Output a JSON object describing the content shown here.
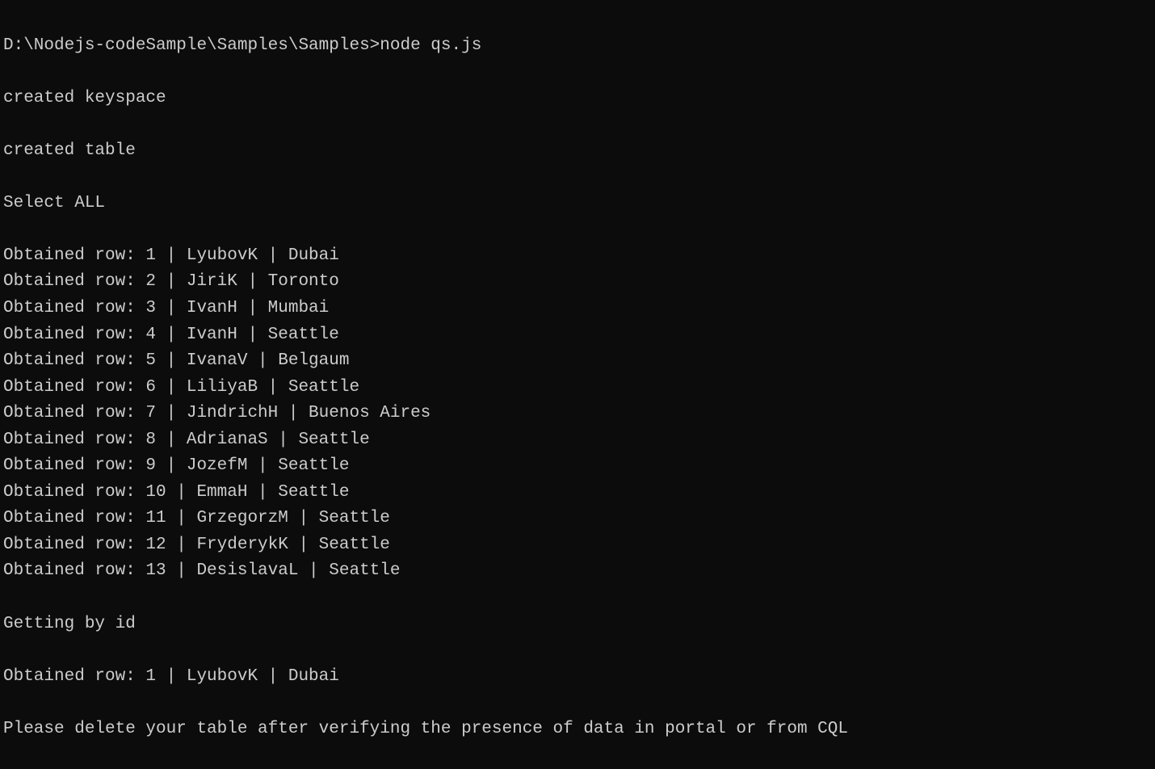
{
  "prompt": {
    "path": "D:\\Nodejs-codeSample\\Samples\\Samples>",
    "command": "node qs.js"
  },
  "output": {
    "created_keyspace": "created keyspace",
    "created_table": "created table",
    "select_all": "Select ALL",
    "rows": [
      {
        "prefix": "Obtained row: ",
        "id": "1",
        "name": "LyubovK",
        "city": "Dubai"
      },
      {
        "prefix": "Obtained row: ",
        "id": "2",
        "name": "JiriK",
        "city": "Toronto"
      },
      {
        "prefix": "Obtained row: ",
        "id": "3",
        "name": "IvanH",
        "city": "Mumbai"
      },
      {
        "prefix": "Obtained row: ",
        "id": "4",
        "name": "IvanH",
        "city": "Seattle"
      },
      {
        "prefix": "Obtained row: ",
        "id": "5",
        "name": "IvanaV",
        "city": "Belgaum"
      },
      {
        "prefix": "Obtained row: ",
        "id": "6",
        "name": "LiliyaB",
        "city": "Seattle"
      },
      {
        "prefix": "Obtained row: ",
        "id": "7",
        "name": "JindrichH",
        "city": "Buenos Aires"
      },
      {
        "prefix": "Obtained row: ",
        "id": "8",
        "name": "AdrianaS",
        "city": "Seattle"
      },
      {
        "prefix": "Obtained row: ",
        "id": "9",
        "name": "JozefM",
        "city": "Seattle"
      },
      {
        "prefix": "Obtained row: ",
        "id": "10",
        "name": "EmmaH",
        "city": "Seattle"
      },
      {
        "prefix": "Obtained row: ",
        "id": "11",
        "name": "GrzegorzM",
        "city": "Seattle"
      },
      {
        "prefix": "Obtained row: ",
        "id": "12",
        "name": "FryderykK",
        "city": "Seattle"
      },
      {
        "prefix": "Obtained row: ",
        "id": "13",
        "name": "DesislavaL",
        "city": "Seattle"
      }
    ],
    "getting_by_id": "Getting by id",
    "by_id_row": {
      "prefix": "Obtained row: ",
      "id": "1",
      "name": "LyubovK",
      "city": "Dubai"
    },
    "final_message": "Please delete your table after verifying the presence of data in portal or from CQL"
  }
}
